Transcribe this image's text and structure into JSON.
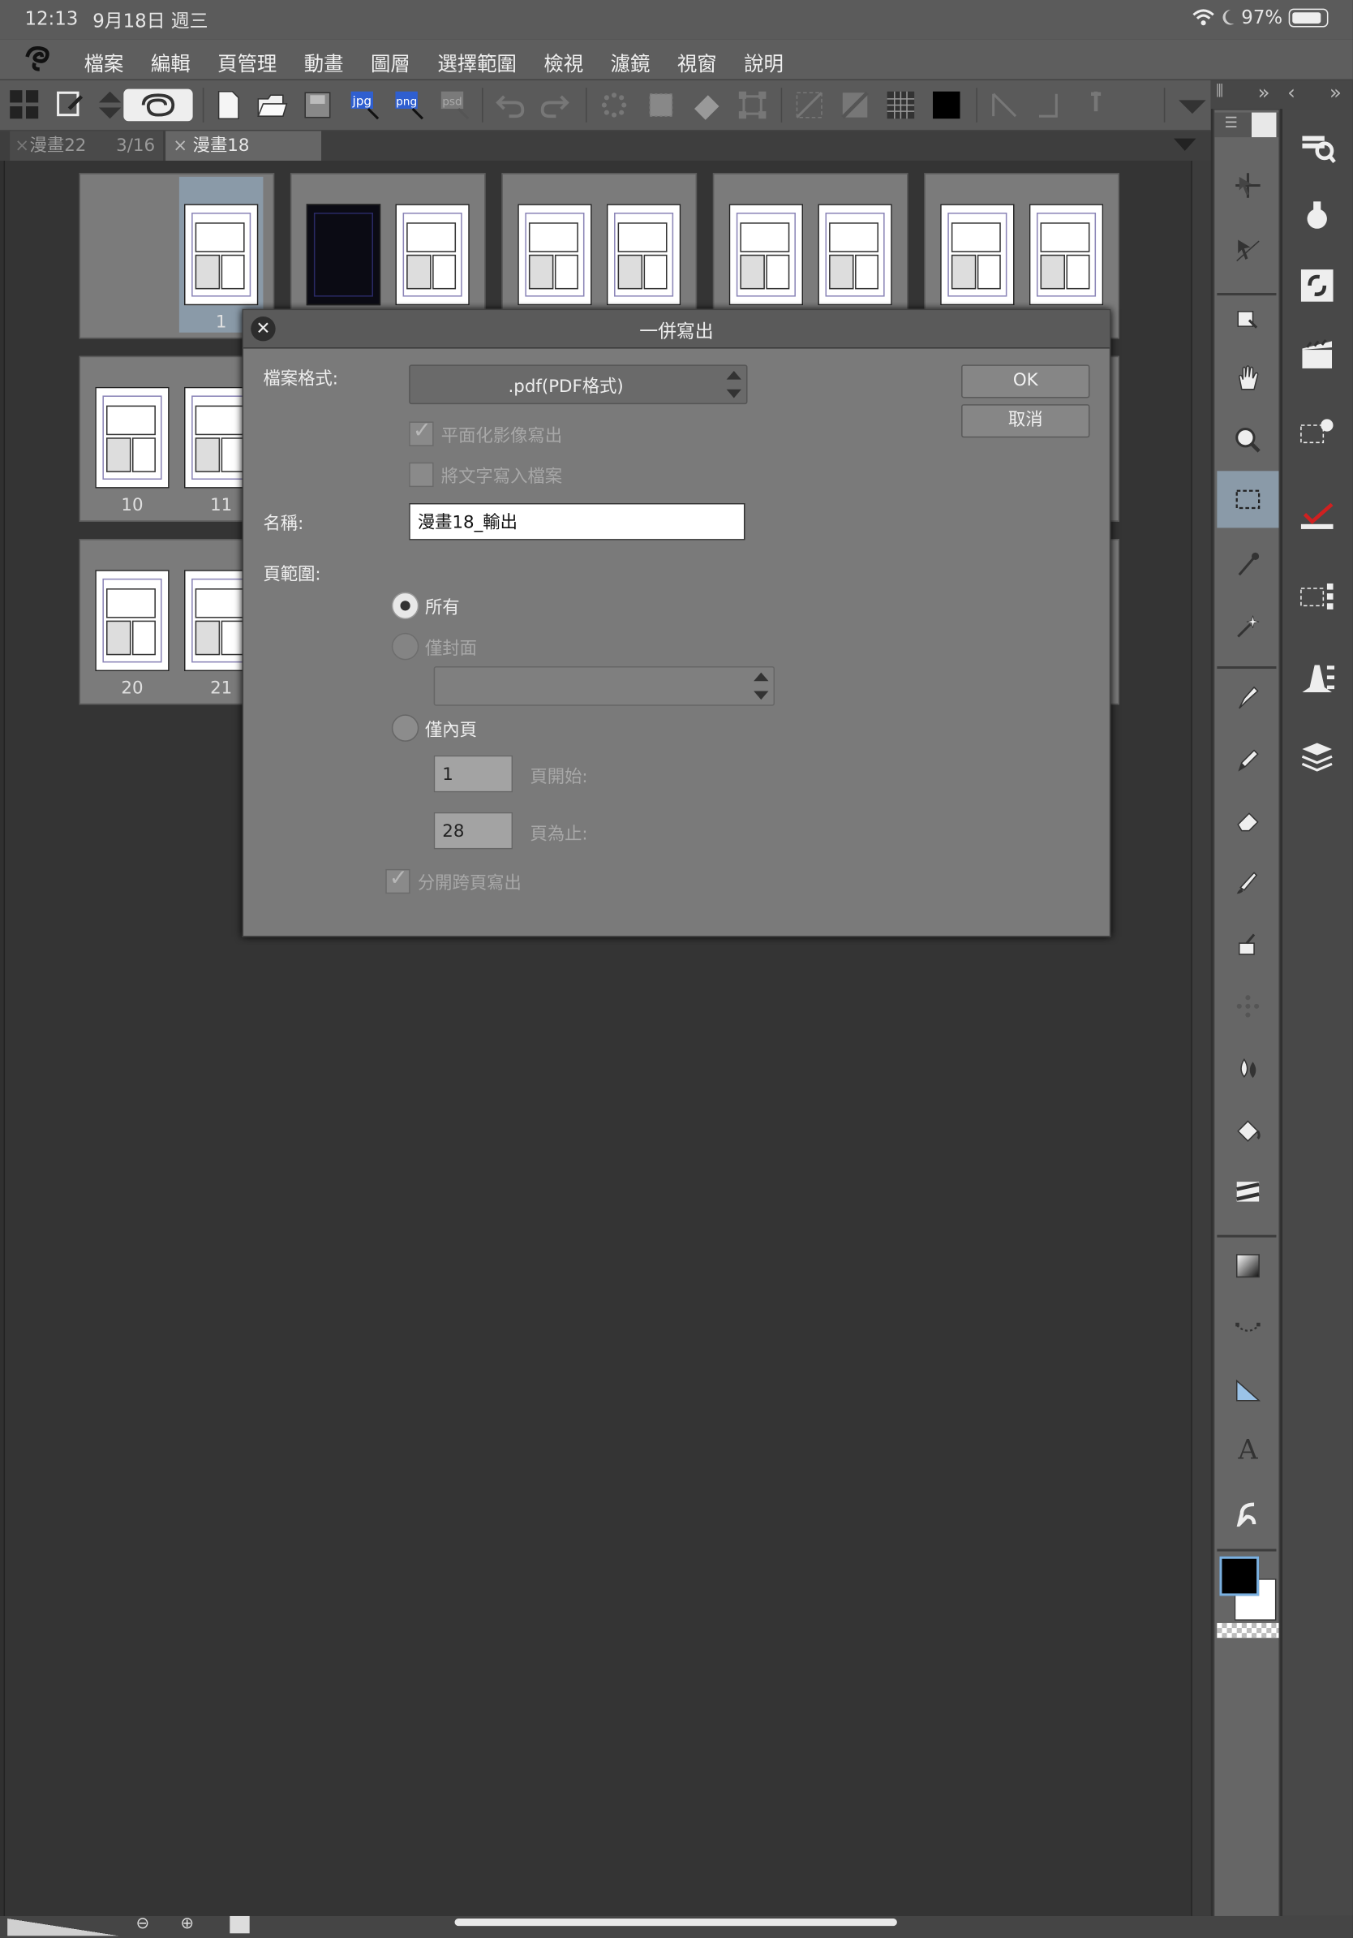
{
  "status_bar": {
    "time": "12:13",
    "date": "9月18日 週三",
    "battery": "97%",
    "battery_level": 0.97
  },
  "menu": [
    "檔案",
    "編輯",
    "頁管理",
    "動畫",
    "圖層",
    "選擇範圍",
    "檢視",
    "濾鏡",
    "視窗",
    "說明"
  ],
  "toolbar": {
    "icons": [
      "grid-icon",
      "page-edit-icon",
      "up-down-icon",
      "swirl-icon",
      "new-file-icon",
      "open-folder-icon",
      "save-icon",
      "export-jpg-icon",
      "export-png-icon",
      "export-psd-icon",
      "undo-icon",
      "redo-icon",
      "clear-icon",
      "fill-selection-icon",
      "eraser-selection-icon",
      "transform-icon",
      "hide-selection-icon",
      "crop-icon",
      "show-grid-icon",
      "black-square-icon",
      "ruler-icon",
      "ruler-edge-icon",
      "pin-icon"
    ],
    "jpg_label": "jpg",
    "png_label": "png",
    "psd_label": "psd"
  },
  "tabs": [
    {
      "name": "漫畫22",
      "pages": "3/16",
      "active": false
    },
    {
      "name": "漫畫18",
      "active": true
    }
  ],
  "pages": [
    {
      "number": "1"
    },
    {
      "number": "10"
    },
    {
      "number": "11"
    },
    {
      "number": "20"
    },
    {
      "number": "21"
    }
  ],
  "dialog": {
    "title": "一併寫出",
    "format_label": "檔案格式:",
    "format_value": ".pdf(PDF格式)",
    "ok": "OK",
    "cancel": "取消",
    "flatten_label": "平面化影像寫出",
    "flatten_checked": true,
    "write_text_label": "將文字寫入檔案",
    "write_text_checked": false,
    "name_label": "名稱:",
    "name_value": "漫畫18_輸出",
    "range_label": "頁範圍:",
    "range_all": "所有",
    "range_cover": "僅封面",
    "range_inner": "僅內頁",
    "start_value": "1",
    "start_label": "頁開始:",
    "end_value": "28",
    "end_label": "頁為止:",
    "split_spread_label": "分開跨頁寫出",
    "split_spread_checked": true
  },
  "tools": [
    "move-icon",
    "selection-pointer-icon",
    "rotate-icon",
    "hand-icon",
    "zoom-icon",
    "rect-select-icon",
    "dropper-icon",
    "magic-wand-icon",
    "pen-icon",
    "pencil-icon",
    "eraser-icon",
    "brush-icon",
    "airbrush-icon",
    "decoration-icon",
    "blend-icon",
    "fill-icon",
    "stripe-icon",
    "gradient-icon",
    "vector-icon",
    "ruler-tool-icon",
    "text-icon",
    "balloon-icon"
  ],
  "subtools": [
    "search-layers-icon",
    "lightbulb-icon",
    "sync-icon",
    "animation-icon",
    "selection-settings-icon",
    "check-icon",
    "layer-select-icon",
    "pen-settings-icon",
    "layers-icon"
  ],
  "colors": {
    "main": "#000000",
    "sub": "#ffffff"
  }
}
